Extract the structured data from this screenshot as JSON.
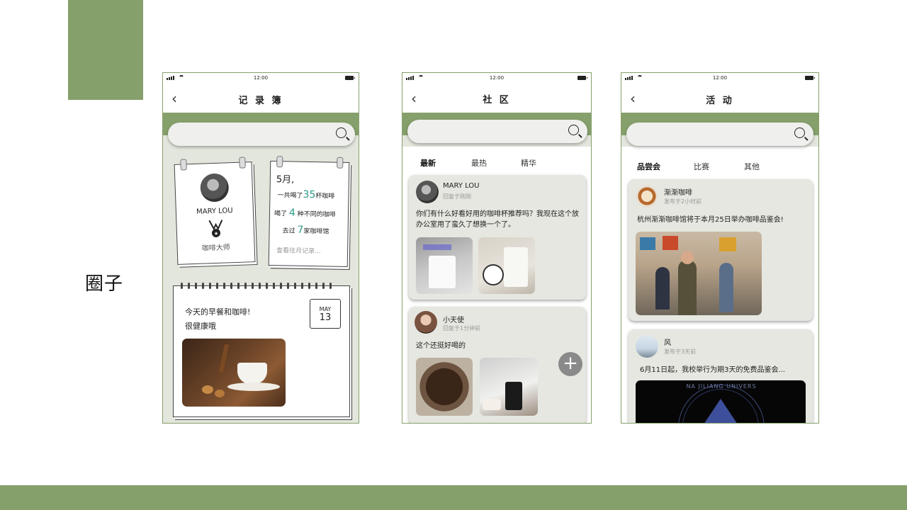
{
  "section_label": "圈子",
  "status_time": "12:00",
  "phone1": {
    "title": "记 录 簿",
    "profile": {
      "name": "MARY LOU",
      "badge": "咖啡大师"
    },
    "stats": {
      "month": "5月,",
      "line1_pre": "一共喝了",
      "line1_num": "35",
      "line1_post": "杯咖啡",
      "line2_pre": "喝了",
      "line2_num": "4",
      "line2_post": "种不同的咖啡",
      "line3_pre": "去过",
      "line3_num": "7",
      "line3_post": "家咖啡馆",
      "history_link": "查看往月记录..."
    },
    "diary": {
      "line1": "今天的早餐和咖啡!",
      "line2": "很健康哦",
      "cal_month": "MAY",
      "cal_day": "13"
    }
  },
  "phone2": {
    "title": "社 区",
    "tabs": [
      "最新",
      "最热",
      "精华"
    ],
    "posts": [
      {
        "name": "MARY LOU",
        "time": "回复于刚刚",
        "text": "你们有什么好看好用的咖啡杯推荐吗？我现在这个放办公室用了蛮久了想换一个了。"
      },
      {
        "name": "小天使",
        "time": "回复于1分钟前",
        "text": "这个还挺好喝的"
      }
    ],
    "fab": "+"
  },
  "phone3": {
    "title": "活 动",
    "tabs": [
      "品尝会",
      "比赛",
      "其他"
    ],
    "posts": [
      {
        "name": "渐渐咖啡",
        "time": "发布于2小时前",
        "text": "杭州渐渐咖啡馆将于本月25日举办咖啡品鉴会!"
      },
      {
        "name": "风",
        "time": "发布于3天前",
        "text": "6月11日起，我校举行为期3天的免费品鉴会...",
        "logo_text": "NA JILIANG UNIVERS"
      }
    ]
  },
  "colors": {
    "accent": "#86a06c",
    "teal": "#2e9a88"
  }
}
